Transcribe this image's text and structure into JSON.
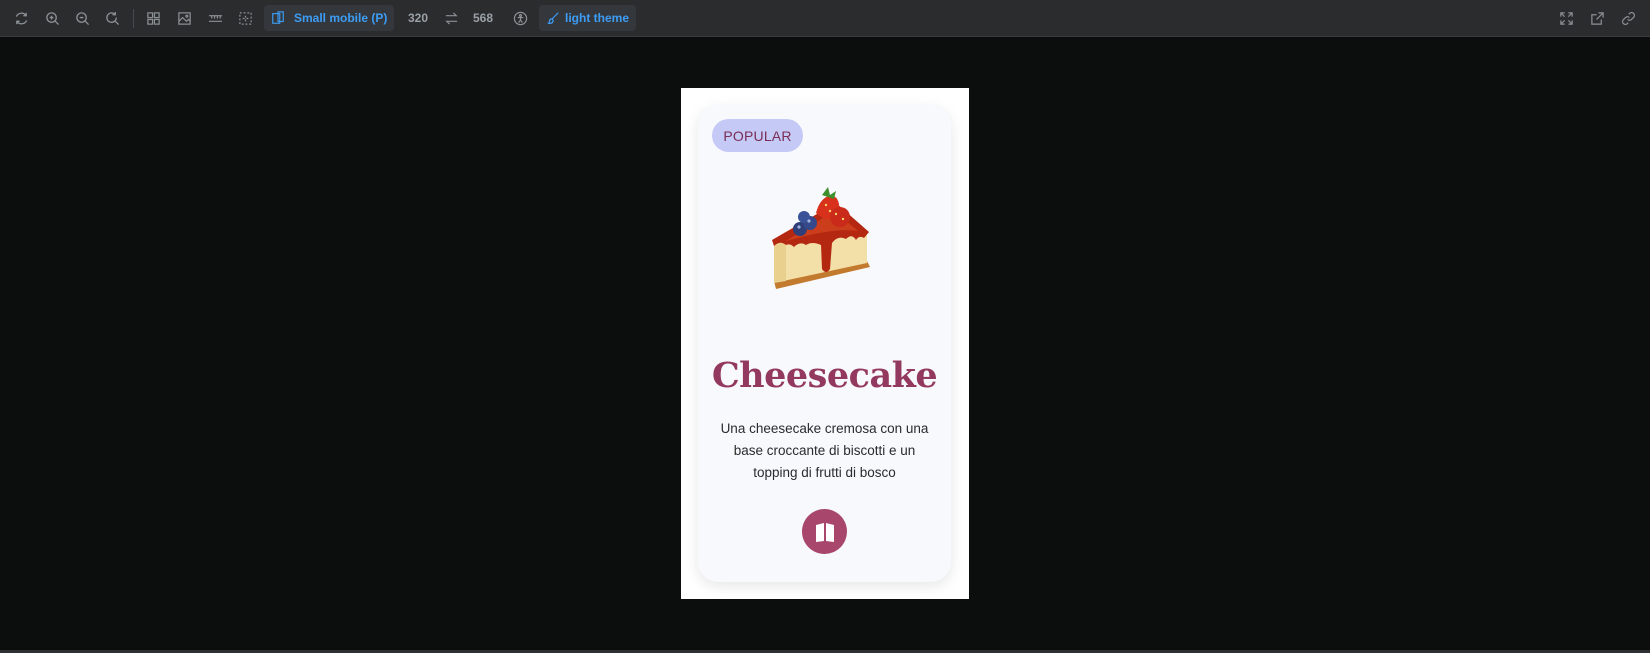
{
  "toolbar": {
    "device_label": "Small mobile (P)",
    "width_value": "320",
    "height_value": "568",
    "theme_label": "light theme",
    "accent_color": "#3d9df6"
  },
  "card": {
    "badge": "POPULAR",
    "title": "Cheesecake",
    "description": "Una cheesecake cremosa con una base croccante di biscotti e un topping di frutti di bosco",
    "image_icon": "cheesecake-slice",
    "action_icon": "book-icon",
    "title_color": "#93395f",
    "badge_bg": "#c5c9f6"
  }
}
